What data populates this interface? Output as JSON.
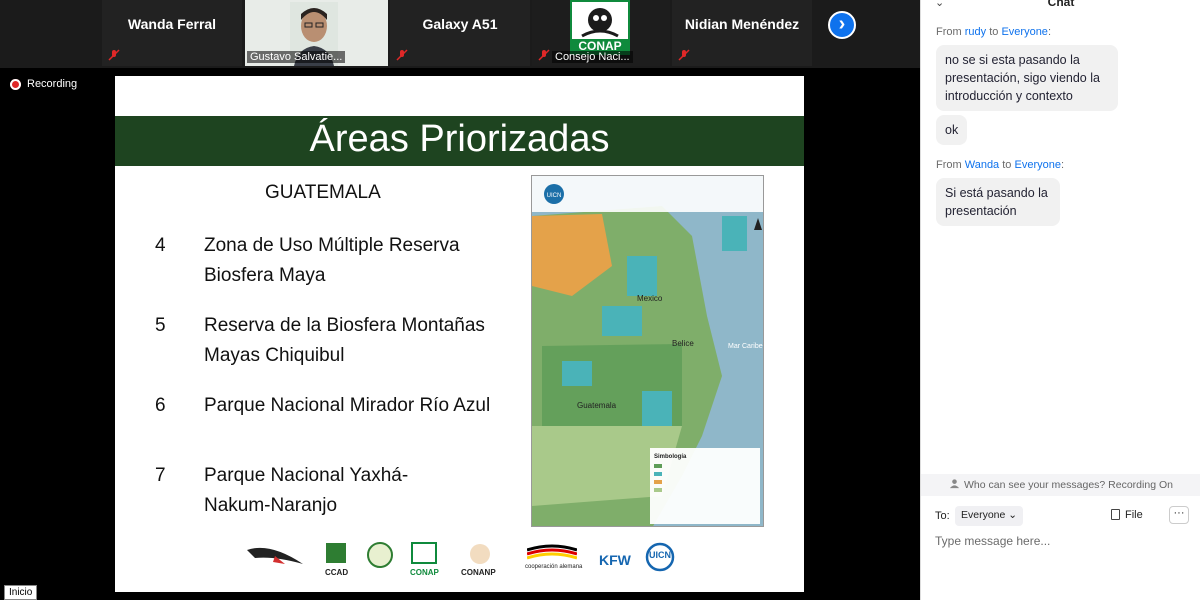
{
  "participants": [
    {
      "name": "Wanda Ferral",
      "muted": true
    },
    {
      "name": "Gustavo Salvatie...",
      "muted": false,
      "video": true
    },
    {
      "name": "Galaxy A51",
      "muted": true
    },
    {
      "name": "Consejo Naci...",
      "muted": true,
      "logo_text": "CONAP"
    },
    {
      "name": "Nidian Menéndez",
      "muted": true
    }
  ],
  "recording_label": "Recording",
  "slide": {
    "title": "Áreas Priorizadas",
    "country": "GUATEMALA",
    "areas": [
      {
        "num": "4",
        "name": "Zona de Uso Múltiple Reserva Biosfera Maya"
      },
      {
        "num": "5",
        "name": "Reserva de la Biosfera Montañas Mayas Chiquibul"
      },
      {
        "num": "6",
        "name": "Parque Nacional Mirador Río Azul"
      },
      {
        "num": "7",
        "name": "Parque Nacional Yaxhá-Nakum-Naranjo"
      }
    ],
    "map": {
      "header": "UICN",
      "labels": [
        "Mexico",
        "Belice",
        "Guatemala",
        "Mar Caribe",
        "Simbología"
      ]
    },
    "logos": [
      "CCAD",
      "CONAP",
      "CONANP",
      "cooperación alemana",
      "KFW",
      "UICN"
    ]
  },
  "taskbar_label": "Inicio",
  "chat": {
    "title": "Chat",
    "messages": [
      {
        "from": "rudy",
        "to": "Everyone",
        "bubbles": [
          "no se si esta pasando la presentación, sigo viendo la introducción y contexto",
          "ok"
        ]
      },
      {
        "from": "Wanda",
        "to": "Everyone",
        "bubbles": [
          "Si está pasando la presentación"
        ]
      }
    ],
    "from_word": "From",
    "to_word": "to",
    "visibility_note": "Who can see your messages? Recording On",
    "to_label": "To:",
    "recipient": "Everyone",
    "file_label": "File",
    "input_placeholder": "Type message here..."
  },
  "colors": {
    "title_bar": "#1e4420",
    "accent": "#0e72ed"
  }
}
